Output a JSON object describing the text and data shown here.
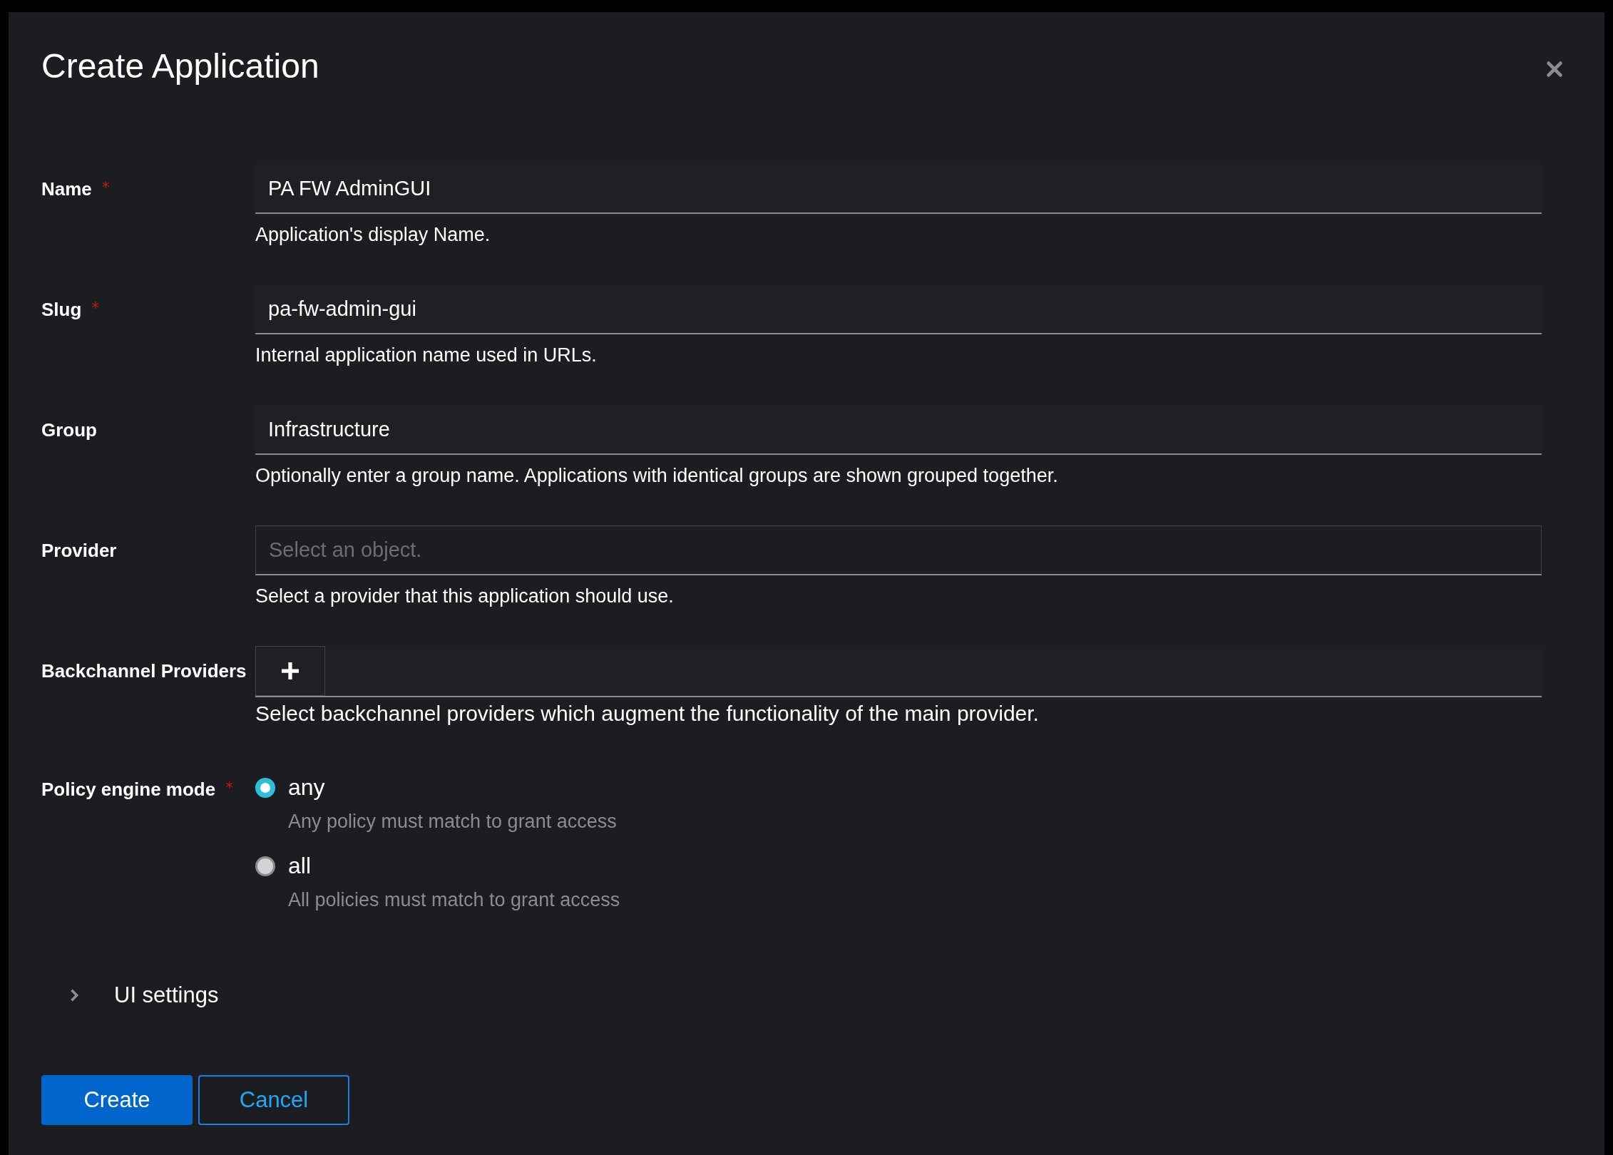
{
  "dialog": {
    "title": "Create Application"
  },
  "fields": [
    {
      "kind": "text",
      "label": "Name",
      "required_mark": "*",
      "value": "PA FW AdminGUI",
      "help": "Application's display Name."
    },
    {
      "kind": "text",
      "label": "Slug",
      "required_mark": "*",
      "value": "pa-fw-admin-gui",
      "help": "Internal application name used in URLs."
    },
    {
      "kind": "text",
      "label": "Group",
      "value": "Infrastructure",
      "help": "Optionally enter a group name. Applications with identical groups are shown grouped together."
    },
    {
      "kind": "select",
      "label": "Provider",
      "placeholder": "Select an object.",
      "help": "Select a provider that this application should use."
    },
    {
      "kind": "multi",
      "label": "Backchannel Providers",
      "help": "Select backchannel providers which augment the functionality of the main provider."
    },
    {
      "kind": "radio",
      "label": "Policy engine mode",
      "required_mark": "*",
      "options": [
        {
          "label": "any",
          "description": "Any policy must match to grant access",
          "selected": true
        },
        {
          "label": "all",
          "description": "All policies must match to grant access",
          "selected": false
        }
      ]
    }
  ],
  "expandable": {
    "label": "UI settings",
    "expanded": false
  },
  "buttons": [
    {
      "label": "Create",
      "kind": "primary"
    },
    {
      "label": "Cancel",
      "kind": "secondary"
    }
  ]
}
